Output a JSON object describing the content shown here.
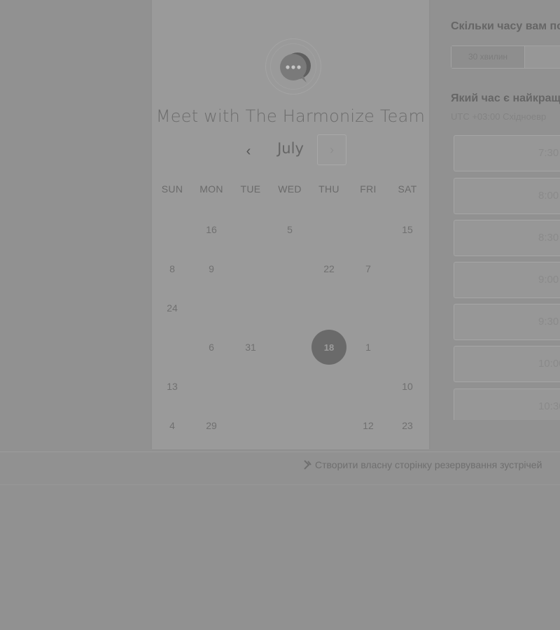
{
  "calendar": {
    "title": "Meet with The Harmonize Team",
    "month": "July",
    "prev_icon": "chevron-left-icon",
    "next_icon": "chevron-right-icon",
    "weekdays": [
      "SUN",
      "MON",
      "TUE",
      "WED",
      "THU",
      "FRI",
      "SAT"
    ],
    "selected_day": "18",
    "weeks": [
      [
        "",
        "16",
        "",
        "5",
        "",
        "",
        "15"
      ],
      [
        "8",
        "9",
        "",
        "",
        "22",
        "7",
        ""
      ],
      [
        "24",
        "",
        "",
        "",
        "",
        "",
        ""
      ],
      [
        "",
        "6",
        "31",
        "",
        "18",
        "1",
        ""
      ],
      [
        "13",
        "",
        "",
        "",
        "",
        "",
        "10"
      ],
      [
        "4",
        "29",
        "",
        "",
        "",
        "12",
        "23"
      ]
    ]
  },
  "duration": {
    "question": "Скільки часу вам по",
    "options": [
      "30 хвилин",
      "1 г"
    ]
  },
  "time": {
    "question": "Який час є найкращ",
    "timezone": "UTC +03:00 Східноевр",
    "slots": [
      "7:30",
      "8:00",
      "8:30",
      "9:00",
      "9:30",
      "10:00",
      "10:30"
    ]
  },
  "footer": {
    "link_text": "Створити власну сторінку резервування зустрічей"
  },
  "colors": {
    "overlay_background": "#919191",
    "card_background": "#9a9a9a",
    "selected_day": "#6a6a6a"
  }
}
